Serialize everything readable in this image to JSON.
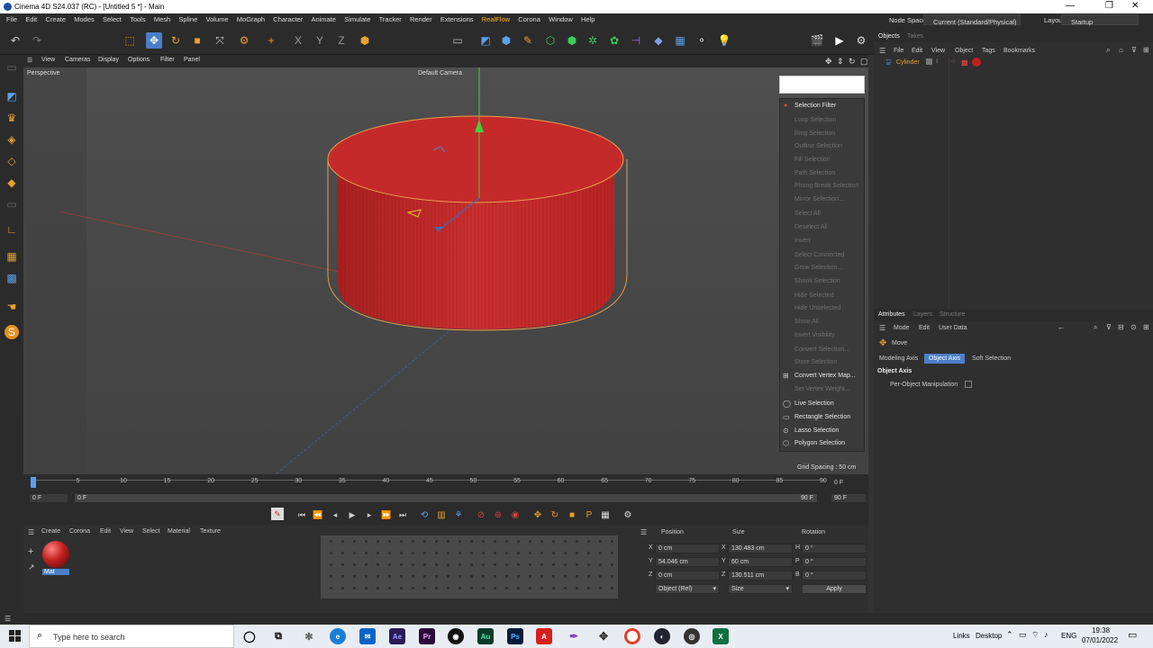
{
  "window": {
    "title": "Cinema 4D S24.037 (RC) - [Untitled 5 *] - Main",
    "minimize": "—",
    "maximize": "❐",
    "close": "✕"
  },
  "menubar": {
    "items": [
      "File",
      "Edit",
      "Create",
      "Modes",
      "Select",
      "Tools",
      "Mesh",
      "Spline",
      "Volume",
      "MoGraph",
      "Character",
      "Animate",
      "Simulate",
      "Tracker",
      "Render",
      "Extensions",
      "RealFlow",
      "Corona",
      "Window",
      "Help"
    ],
    "node_space_label": "Node Space:",
    "node_space_value": "Current (Standard/Physical)",
    "layout_label": "Layout:",
    "layout_value": "Startup"
  },
  "viewport_menu": {
    "items": [
      "View",
      "Cameras",
      "Display",
      "Options",
      "Filter",
      "Panel"
    ],
    "view_name": "Perspective",
    "camera": "Default Camera",
    "grid_spacing": "Grid Spacing : 50 cm"
  },
  "selection_menu": {
    "header": "Selection Filter",
    "items": [
      {
        "label": "Loop Selection",
        "enabled": false
      },
      {
        "label": "Ring Selection",
        "enabled": false
      },
      {
        "label": "Outline Selection",
        "enabled": false
      },
      {
        "label": "Fill Selection",
        "enabled": false
      },
      {
        "label": "Path Selection",
        "enabled": false
      },
      {
        "label": "Phong Break Selection",
        "enabled": false
      },
      {
        "label": "Mirror Selection...",
        "enabled": false
      },
      {
        "label": "Select All",
        "enabled": false
      },
      {
        "label": "Deselect All",
        "enabled": false
      },
      {
        "label": "Invert",
        "enabled": false
      },
      {
        "label": "Select Connected",
        "enabled": false
      },
      {
        "label": "Grow Selection...",
        "enabled": false
      },
      {
        "label": "Shrink Selection",
        "enabled": false
      },
      {
        "label": "Hide Selected",
        "enabled": false
      },
      {
        "label": "Hide Unselected",
        "enabled": false
      },
      {
        "label": "Show All",
        "enabled": false
      },
      {
        "label": "Invert Visibility",
        "enabled": false
      },
      {
        "label": "Convert Selection...",
        "enabled": false
      },
      {
        "label": "Store Selection",
        "enabled": false
      },
      {
        "label": "Convert Vertex Map...",
        "enabled": true
      },
      {
        "label": "Set Vertex Weight...",
        "enabled": false
      },
      {
        "label": "Live Selection",
        "enabled": true
      },
      {
        "label": "Rectangle Selection",
        "enabled": true
      },
      {
        "label": "Lasso Selection",
        "enabled": true
      },
      {
        "label": "Polygon Selection",
        "enabled": true
      }
    ]
  },
  "timeline": {
    "ticks": [
      "0",
      "5",
      "10",
      "15",
      "20",
      "25",
      "30",
      "35",
      "40",
      "45",
      "50",
      "55",
      "60",
      "65",
      "70",
      "75",
      "80",
      "85",
      "90"
    ],
    "current_frame": "0 F",
    "start": "0 F",
    "range_start": "0 F",
    "range_end": "90 F",
    "end": "90 F"
  },
  "material_manager": {
    "menu": [
      "Create",
      "Corona",
      "Edit",
      "View",
      "Select",
      "Material",
      "Texture"
    ],
    "material_name": "Mat"
  },
  "coordinates": {
    "headers": [
      "Position",
      "Size",
      "Rotation"
    ],
    "rows": [
      {
        "axis": "X",
        "pos": "0 cm",
        "size_axis": "X",
        "size": "130.483 cm",
        "rot_axis": "H",
        "rot": "0 °"
      },
      {
        "axis": "Y",
        "pos": "54.046 cm",
        "size_axis": "Y",
        "size": "60 cm",
        "rot_axis": "P",
        "rot": "0 °"
      },
      {
        "axis": "Z",
        "pos": "0 cm",
        "size_axis": "Z",
        "size": "130.511 cm",
        "rot_axis": "B",
        "rot": "0 °"
      }
    ],
    "mode": "Object (Rel)",
    "size_mode": "Size",
    "apply": "Apply"
  },
  "object_manager": {
    "tabs": [
      "Objects",
      "Takes"
    ],
    "menu": [
      "File",
      "Edit",
      "View",
      "Object",
      "Tags",
      "Bookmarks"
    ],
    "object_name": "Cylinder"
  },
  "attributes": {
    "tabs": [
      "Attributes",
      "Layers",
      "Structure"
    ],
    "menu": [
      "Mode",
      "Edit",
      "User Data"
    ],
    "tool": "Move",
    "subtabs": [
      "Modeling Axis",
      "Object Axis",
      "Soft Selection"
    ],
    "section": "Object Axis",
    "option": "Per-Object Manipulation"
  },
  "taskbar": {
    "search_placeholder": "Type here to search",
    "links": "Links",
    "desktop": "Desktop",
    "lang": "ENG",
    "time": "19:38",
    "date": "07/01/2022"
  },
  "colors": {
    "accent": "#4a7fc8",
    "realflow": "#ffb028",
    "cylinder": "#c42a2a"
  }
}
